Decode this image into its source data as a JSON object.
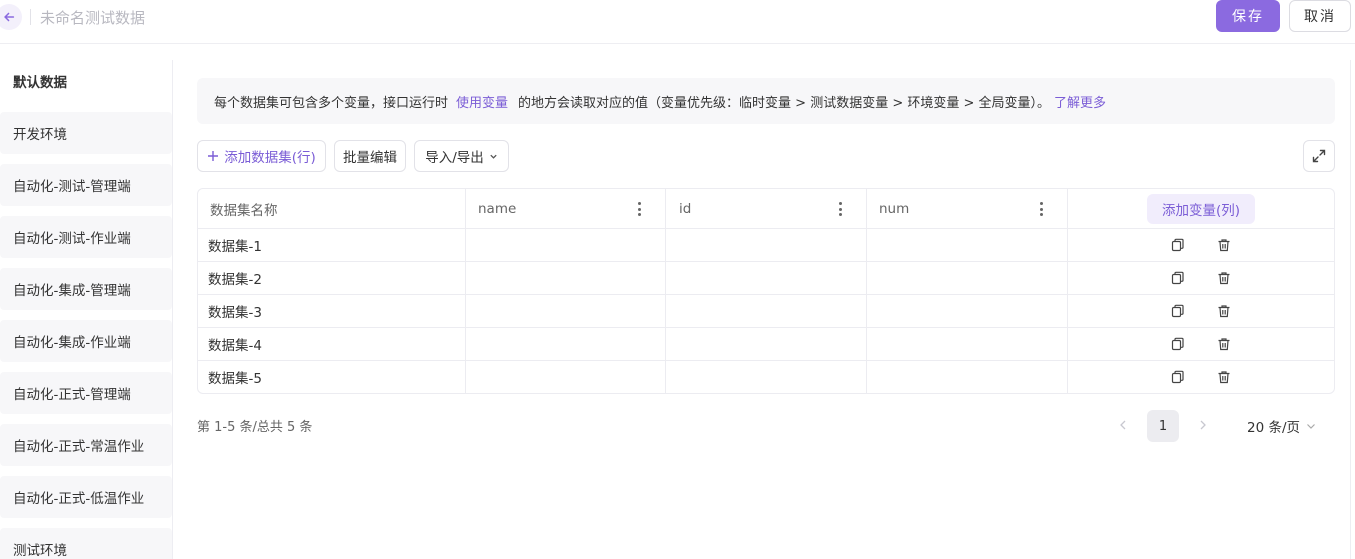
{
  "header": {
    "back_icon": "arrow-left-icon",
    "title": "未命名测试数据",
    "save_label": "保存",
    "cancel_label": "取消"
  },
  "sidebar": {
    "items": [
      {
        "label": "默认数据",
        "active": true
      },
      {
        "label": "开发环境"
      },
      {
        "label": "自动化-测试-管理端"
      },
      {
        "label": "自动化-测试-作业端"
      },
      {
        "label": "自动化-集成-管理端"
      },
      {
        "label": "自动化-集成-作业端"
      },
      {
        "label": "自动化-正式-管理端"
      },
      {
        "label": "自动化-正式-常温作业"
      },
      {
        "label": "自动化-正式-低温作业"
      },
      {
        "label": "测试环境"
      }
    ]
  },
  "info": {
    "text_before": "每个数据集可包含多个变量，接口运行时",
    "link_use_var": "使用变量",
    "text_after": "的地方会读取对应的值（变量优先级：临时变量 > 测试数据变量 > 环境变量 > 全局变量）。",
    "link_learn_more": "了解更多"
  },
  "toolbar": {
    "add_dataset_label": "添加数据集(行)",
    "batch_edit_label": "批量编辑",
    "import_export_label": "导入/导出",
    "expand_icon": "expand-icon"
  },
  "table": {
    "columns": [
      "数据集名称",
      "name",
      "id",
      "num"
    ],
    "add_variable_label": "添加变量(列)",
    "rows": [
      {
        "name": "数据集-1",
        "values": [
          "",
          "",
          ""
        ]
      },
      {
        "name": "数据集-2",
        "values": [
          "",
          "",
          ""
        ]
      },
      {
        "name": "数据集-3",
        "values": [
          "",
          "",
          ""
        ]
      },
      {
        "name": "数据集-4",
        "values": [
          "",
          "",
          ""
        ]
      },
      {
        "name": "数据集-5",
        "values": [
          "",
          "",
          ""
        ]
      }
    ],
    "row_icons": [
      "copy-icon",
      "trash-icon"
    ]
  },
  "pagination": {
    "total_text": "第 1-5 条/总共 5 条",
    "current_page": "1",
    "page_size": "20 条/页"
  },
  "colors": {
    "accent": "#8b6ae0",
    "link": "#7b5dd6"
  }
}
